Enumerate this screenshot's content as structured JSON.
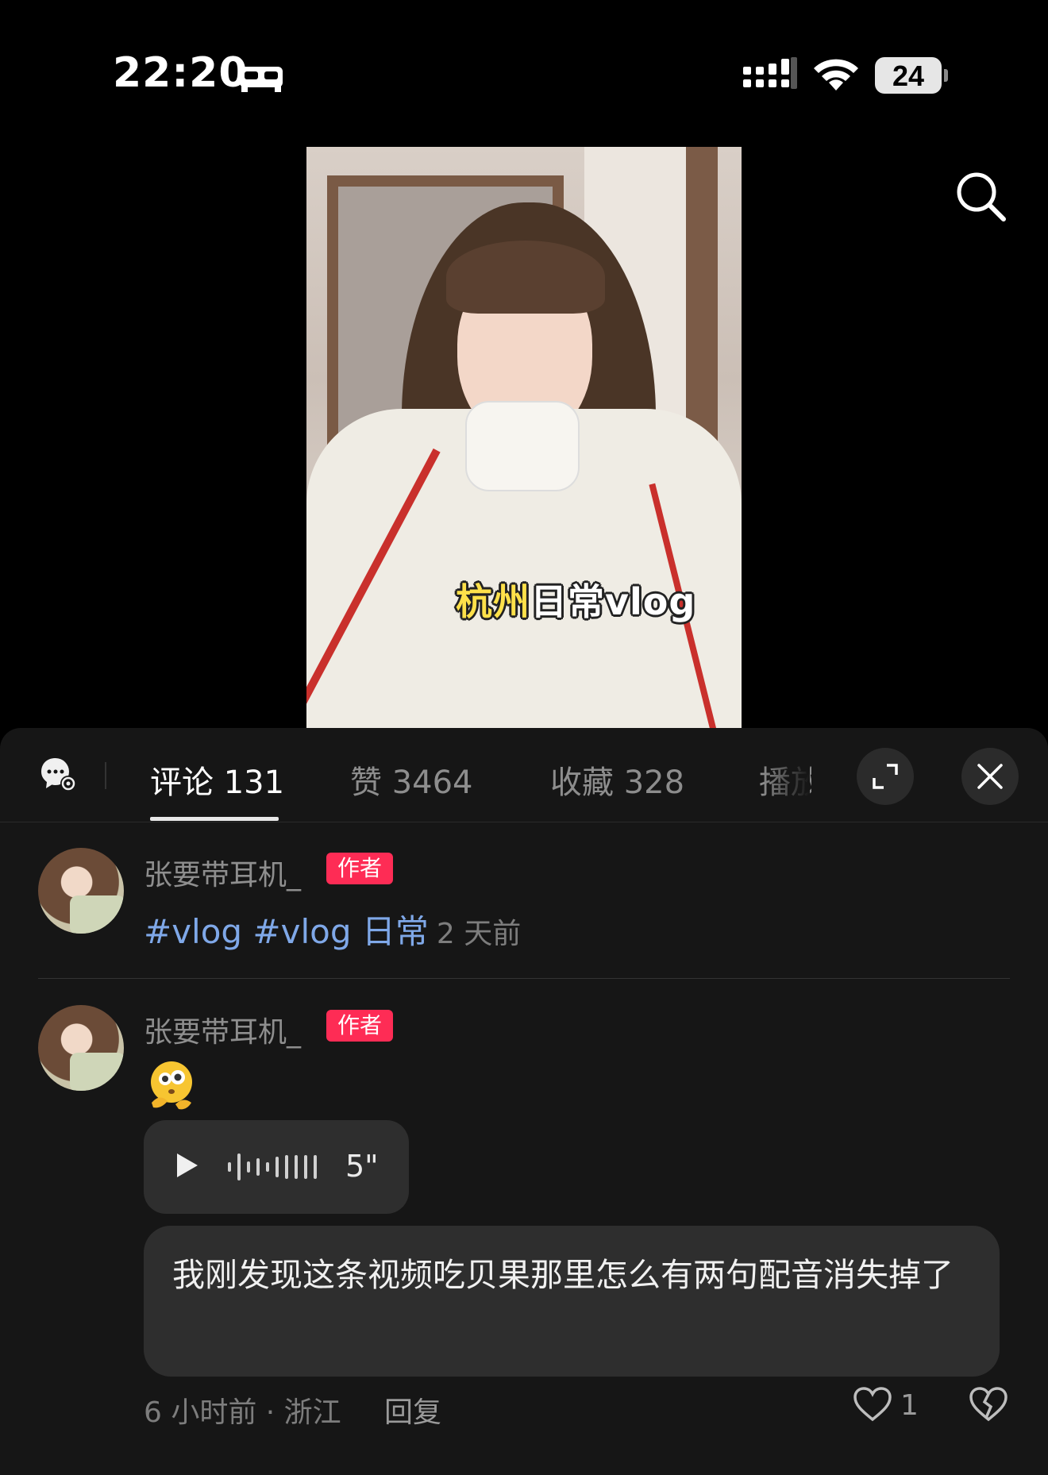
{
  "status_bar": {
    "time": "22:20",
    "battery": "24"
  },
  "video": {
    "caption_highlight": "杭州",
    "caption_rest": "日常vlog"
  },
  "tabs": [
    {
      "label": "评论 131",
      "active": true
    },
    {
      "label": "赞 3464",
      "active": false
    },
    {
      "label": "收藏 328",
      "active": false
    },
    {
      "label": "播放",
      "active": false
    }
  ],
  "comments": [
    {
      "user": "张要带耳机_",
      "badge": "作者",
      "hashtags": "#vlog #vlog 日常",
      "time": "2 天前"
    },
    {
      "user": "张要带耳机_",
      "badge": "作者",
      "voice_duration": "5\"",
      "text": "我刚发现这条视频吃贝果那里怎么有两句配音消失掉了",
      "meta": "6 小时前 · 浙江",
      "reply_label": "回复",
      "likes": "1"
    }
  ],
  "colors": {
    "accent_badge": "#fe2c55",
    "hashtag": "#7fa8e8",
    "panel_bg": "#161616"
  }
}
